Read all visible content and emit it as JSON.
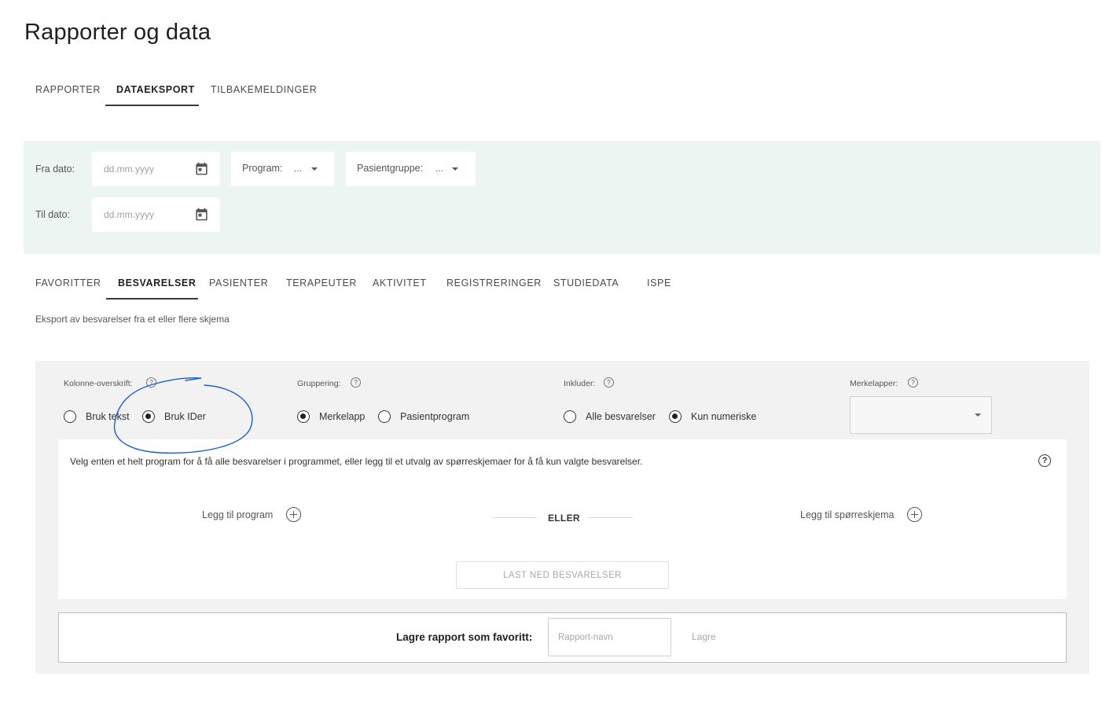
{
  "page": {
    "title": "Rapporter og data"
  },
  "main_tabs": [
    {
      "label": "RAPPORTER",
      "active": false
    },
    {
      "label": "DATAEKSPORT",
      "active": true
    },
    {
      "label": "TILBAKEMELDINGER",
      "active": false
    }
  ],
  "filters": {
    "from_label": "Fra dato:",
    "to_label": "Til dato:",
    "date_placeholder": "dd.mm.yyyy",
    "program_label": "Program:",
    "program_value": "...",
    "patient_group_label": "Pasientgruppe:",
    "patient_group_value": "...",
    "background_color": "#ecf5f1"
  },
  "sub_tabs": [
    {
      "label": "FAVORITTER",
      "active": false
    },
    {
      "label": "BESVARELSER",
      "active": true
    },
    {
      "label": "PASIENTER",
      "active": false
    },
    {
      "label": "TERAPEUTER",
      "active": false
    },
    {
      "label": "AKTIVITET",
      "active": false
    },
    {
      "label": "REGISTRERINGER",
      "active": false
    },
    {
      "label": "STUDIEDATA",
      "active": false
    },
    {
      "label": "ISPE",
      "active": false
    }
  ],
  "description": "Eksport av besvarelser fra et eller flere skjema",
  "options": {
    "column_header": {
      "label": "Kolonne-overskrift:",
      "choices": [
        {
          "label": "Bruk tekst",
          "selected": false
        },
        {
          "label": "Bruk IDer",
          "selected": true
        }
      ]
    },
    "grouping": {
      "label": "Gruppering:",
      "choices": [
        {
          "label": "Merkelapp",
          "selected": true
        },
        {
          "label": "Pasientprogram",
          "selected": false
        }
      ]
    },
    "include": {
      "label": "Inkluder:",
      "choices": [
        {
          "label": "Alle besvarelser",
          "selected": false
        },
        {
          "label": "Kun numeriske",
          "selected": true
        }
      ]
    },
    "labels": {
      "label": "Merkelapper:",
      "value": ""
    }
  },
  "selection": {
    "instruction": "Velg enten et helt program for å få alle besvarelser i programmet, eller legg til et utvalg av spørreskjemaer for å få kun valgte besvarelser.",
    "add_program": "Legg til program",
    "or": "ELLER",
    "add_questionnaire": "Legg til spørreskjema",
    "download": "LAST NED BESVARELSER"
  },
  "favorite": {
    "label": "Lagre rapport som favoritt:",
    "name_placeholder": "Rapport-navn",
    "save": "Lagre"
  },
  "annotation_color": "#1a5fd0"
}
